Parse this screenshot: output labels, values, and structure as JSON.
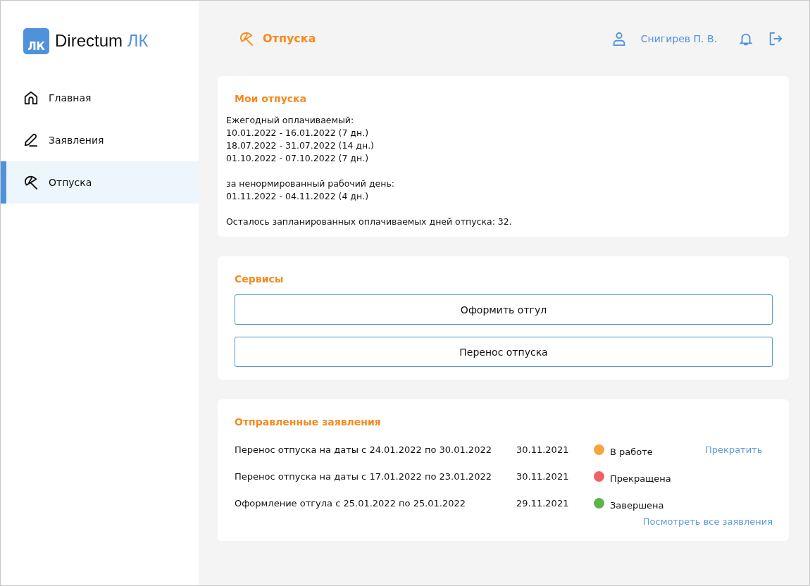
{
  "logo": {
    "badge": "ЛК",
    "name": "Directum",
    "suffix": "ЛК"
  },
  "sidebar": {
    "items": [
      {
        "label": "Главная",
        "kind": "home",
        "selected": false
      },
      {
        "label": "Заявления",
        "kind": "pen",
        "selected": false
      },
      {
        "label": "Отпуска",
        "kind": "umbrella",
        "selected": true
      }
    ]
  },
  "header": {
    "title": "Отпуска",
    "user": "Снигирев П. В."
  },
  "my_vacations": {
    "title": "Мои отпуска",
    "groups": [
      {
        "heading": "Ежегодный оплачиваемый:",
        "lines": [
          "10.01.2022 - 16.01.2022 (7 дн.)",
          "18.07.2022 - 31.07.2022 (14 дн.)",
          "01.10.2022 - 07.10.2022 (7 дн.)"
        ]
      },
      {
        "heading": "за ненормированный рабочий день:",
        "lines": [
          "01.11.2022 - 04.11.2022 (4 дн.)"
        ]
      }
    ],
    "remaining": "Осталось запланированных оплачиваемых дней отпуска: 32."
  },
  "services": {
    "title": "Сервисы",
    "buttons": [
      "Оформить отгул",
      "Перенос отпуска"
    ]
  },
  "requests": {
    "title": "Отправленные заявления",
    "rows": [
      {
        "name": "Перенос отпуска на даты с 24.01.2022 по 30.01.2022",
        "date": "30.11.2021",
        "status": "В работе",
        "color": "#f9a43a",
        "action": "Прекратить"
      },
      {
        "name": "Перенос отпуска на даты с 17.01.2022 по 23.01.2022",
        "date": "30.11.2021",
        "status": "Прекращена",
        "color": "#f26161"
      },
      {
        "name": "Оформление отгула с 25.01.2022 по 25.01.2022",
        "date": "29.11.2021",
        "status": "Завершена",
        "color": "#5bb54a"
      }
    ],
    "view_all": "Посмотреть все заявления"
  }
}
